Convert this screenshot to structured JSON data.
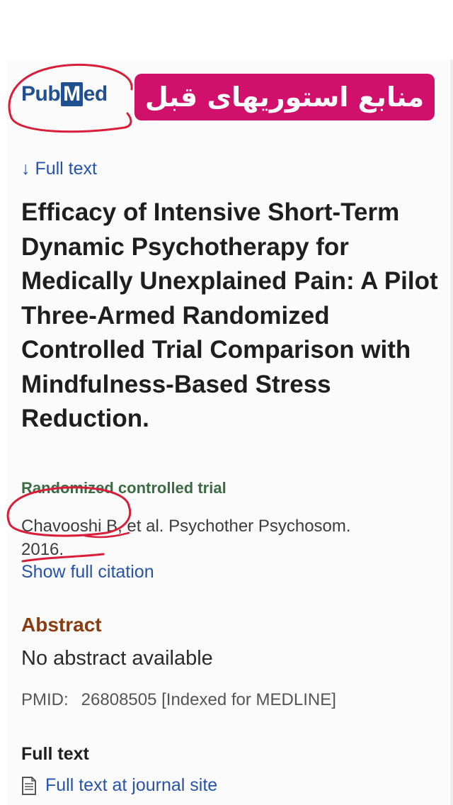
{
  "logo": {
    "pub": "Pub",
    "m": "M",
    "ed": "ed"
  },
  "banner": {
    "text": "منابع استوریهای قبل"
  },
  "full_text_link": {
    "arrow": "↓",
    "label": "Full text"
  },
  "article": {
    "title": "Efficacy of Intensive Short-Term Dynamic Psychotherapy for Medically Unexplained Pain: A Pilot Three-Armed Randomized Controlled Trial Comparison with Mindfulness-Based Stress Reduction.",
    "publication_type": "Randomized controlled trial",
    "citation_line1": "Chavooshi B, et al. Psychother Psychosom.",
    "citation_line2": "2016.",
    "show_full_citation": "Show full citation"
  },
  "abstract": {
    "heading": "Abstract",
    "text": "No abstract available"
  },
  "pmid": {
    "label": "PMID:",
    "value": "26808505 [Indexed for MEDLINE]"
  },
  "full_text_section": {
    "heading": "Full text",
    "link_label": "Full text at journal site",
    "icon": "document-icon"
  },
  "colors": {
    "banner": "#d0106a",
    "link": "#2753a8",
    "abstract_heading": "#8a3c0f",
    "pubtype": "#3d6b45",
    "annotation": "#d81e3a"
  }
}
